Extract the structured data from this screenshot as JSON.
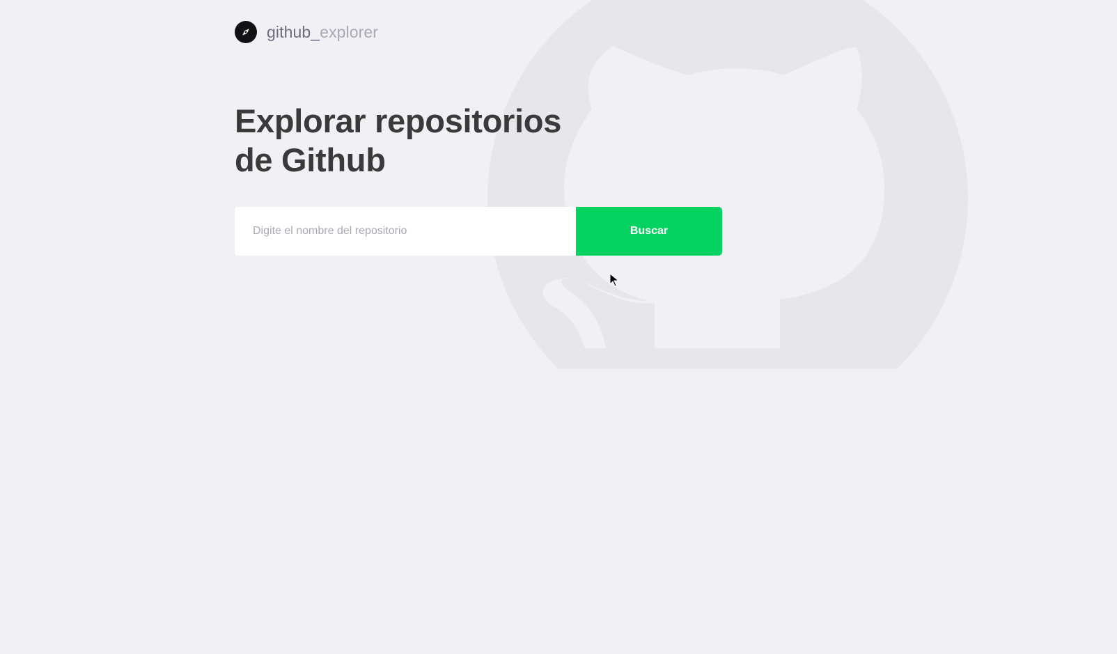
{
  "app": {
    "logo_name": "compass-icon",
    "logo_text_main": "github_",
    "logo_text_accent": "explorer"
  },
  "main": {
    "title_line1": "Explorar repositorios",
    "title_line2": "de Github"
  },
  "search": {
    "placeholder": "Digite el nombre del repositorio",
    "value": "",
    "button_label": "Buscar"
  },
  "colors": {
    "background": "#f0f0f5",
    "button": "#04d361",
    "title": "#3a3a3a",
    "logo_text": "#6c6c80",
    "placeholder": "#a8a8b3"
  }
}
